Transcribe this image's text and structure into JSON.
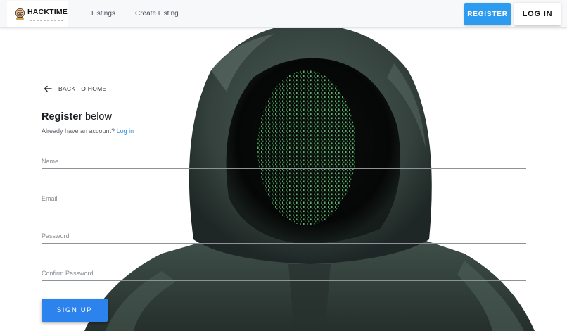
{
  "brand": {
    "name": "HACKTIME",
    "logo_icon": "cartoon-hacker-face-icon"
  },
  "nav": {
    "listings_label": "Listings",
    "create_listing_label": "Create Listing",
    "register_label": "REGISTER",
    "login_label": "LOG IN"
  },
  "back": {
    "icon": "arrow-left-icon",
    "label": "BACK TO HOME"
  },
  "form": {
    "title_bold": "Register",
    "title_rest": " below",
    "subtitle_text": "Already have an account? ",
    "subtitle_link": "Log in",
    "fields": {
      "name_placeholder": "Name",
      "email_placeholder": "Email",
      "password_placeholder": "Password",
      "confirm_placeholder": "Confirm Password"
    },
    "submit_label": "SIGN UP"
  },
  "colors": {
    "primary": "#2c83ee",
    "register": "#2d9cf0",
    "link": "#2b8fe0",
    "hoodie": "#3d4c47",
    "matrix_green": "#7fe08a"
  }
}
